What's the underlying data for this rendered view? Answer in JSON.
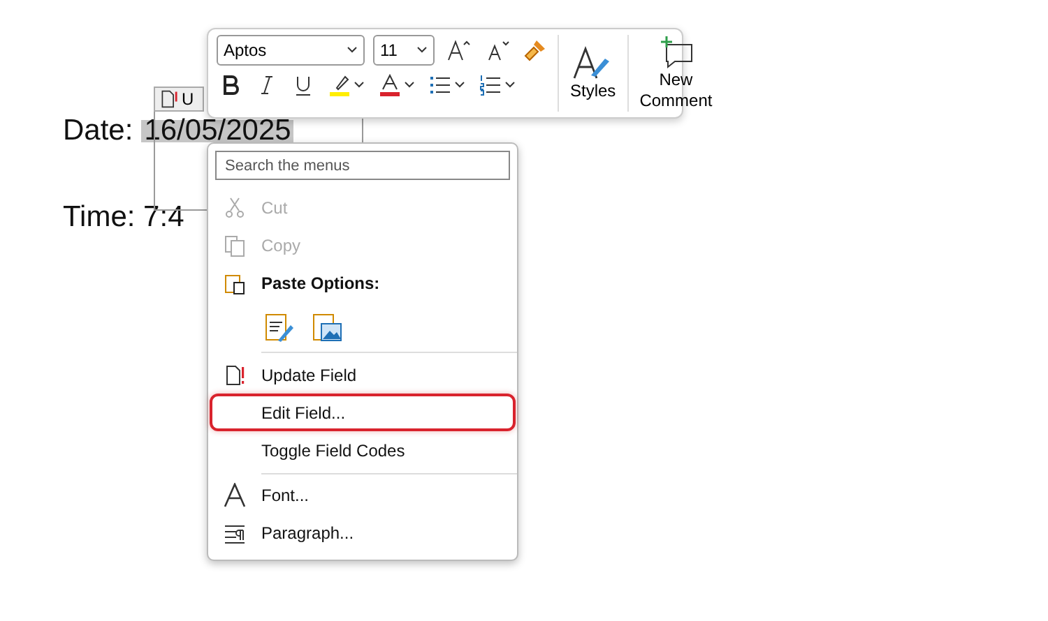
{
  "document": {
    "date": {
      "label": "Date:",
      "field": "16/05/2025",
      "field_selected": true
    },
    "time": {
      "text": "Time: 7:4"
    },
    "field_tab": {
      "text": "U"
    }
  },
  "mini_toolbar": {
    "font_name": "Aptos",
    "font_size": "11",
    "styles_label": "Styles",
    "new_comment_label": "New Comment"
  },
  "context_menu": {
    "search": {
      "placeholder": "Search the menus"
    },
    "items": [
      {
        "kind": "item",
        "label": "Cut",
        "disabled": true,
        "highlighted": false
      },
      {
        "kind": "item",
        "label": "Copy",
        "disabled": true,
        "highlighted": false
      },
      {
        "kind": "header",
        "label": "Paste Options:"
      },
      {
        "kind": "paste_row"
      },
      {
        "kind": "separator"
      },
      {
        "kind": "item",
        "label": "Update Field",
        "disabled": false,
        "highlighted": false
      },
      {
        "kind": "item",
        "label": "Edit Field...",
        "disabled": false,
        "highlighted": true
      },
      {
        "kind": "item",
        "label": "Toggle Field Codes",
        "disabled": false,
        "highlighted": false
      },
      {
        "kind": "separator"
      },
      {
        "kind": "item",
        "label": "Font...",
        "disabled": false,
        "highlighted": false
      },
      {
        "kind": "item",
        "label": "Paragraph...",
        "disabled": false,
        "highlighted": false
      }
    ]
  }
}
